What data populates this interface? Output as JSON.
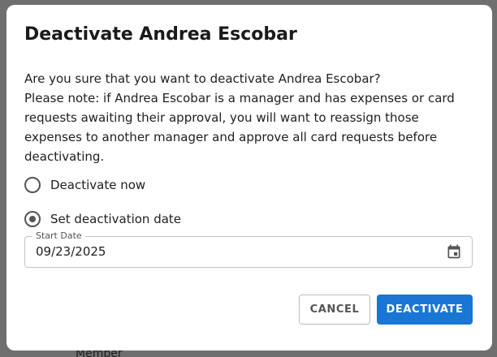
{
  "backdrop": {
    "partial_text": "Member"
  },
  "dialog": {
    "title": "Deactivate Andrea Escobar",
    "question": "Are you sure that you want to deactivate Andrea Escobar?",
    "note": "Please note: if Andrea Escobar is a manager and has expenses or card requests awaiting their approval, you will want to reassign those expenses to another manager and approve all card requests before deactivating.",
    "options": [
      {
        "label": "Deactivate now",
        "selected": false
      },
      {
        "label": "Set deactivation date",
        "selected": true
      }
    ],
    "start_date": {
      "label": "Start Date",
      "value": "09/23/2025",
      "icon": "calendar-icon"
    },
    "buttons": {
      "cancel": "CANCEL",
      "deactivate": "DEACTIVATE"
    }
  },
  "colors": {
    "primary": "#1976d2",
    "backdrop": "#6f6f6f"
  }
}
